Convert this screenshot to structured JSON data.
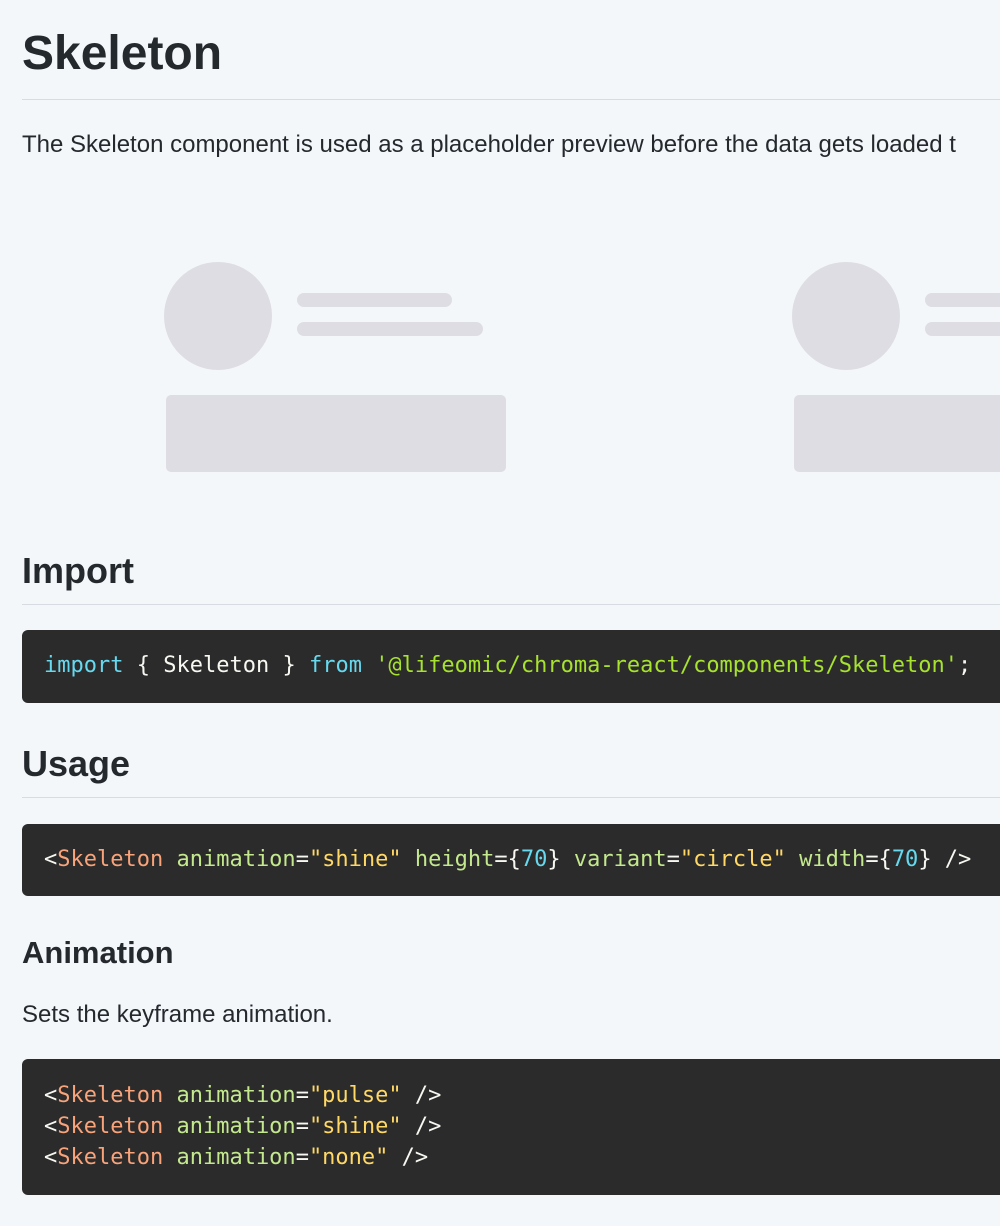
{
  "page": {
    "title": "Skeleton",
    "intro": "The Skeleton component is used as a placeholder preview before the data gets loaded t"
  },
  "sections": {
    "import": {
      "heading": "Import",
      "code": {
        "kw_import": "import",
        "brace_open": " { ",
        "name": "Skeleton",
        "brace_close": " } ",
        "kw_from": "from",
        "space": " ",
        "path": "'@lifeomic/chroma-react/components/Skeleton'",
        "semicolon": ";"
      }
    },
    "usage": {
      "heading": "Usage",
      "code": {
        "lt": "<",
        "tag": "Skeleton",
        "a1": "animation",
        "eq1": "=",
        "v1": "\"shine\"",
        "a2": "height",
        "eq2": "={",
        "v2": "70",
        "cb2": "}",
        "a3": "variant",
        "eq3": "=",
        "v3": "\"circle\"",
        "a4": "width",
        "eq4": "={",
        "v4": "70",
        "cb4": "}",
        "close": " />"
      }
    },
    "animation": {
      "heading": "Animation",
      "description": "Sets the keyframe animation.",
      "lines": [
        {
          "lt": "<",
          "tag": "Skeleton",
          "attr": "animation",
          "eq": "=",
          "value": "\"pulse\"",
          "close": " />"
        },
        {
          "lt": "<",
          "tag": "Skeleton",
          "attr": "animation",
          "eq": "=",
          "value": "\"shine\"",
          "close": " />"
        },
        {
          "lt": "<",
          "tag": "Skeleton",
          "attr": "animation",
          "eq": "=",
          "value": "\"none\"",
          "close": " />"
        }
      ]
    }
  },
  "colors": {
    "page_bg": "#f4f7fa",
    "skeleton_fill": "#dddde3",
    "code_bg": "#2b2b2b",
    "keyword": "#66d9ef",
    "string": "#a6e22e",
    "tag": "#f8a37a",
    "attribute": "#c3e88d",
    "attribute_value": "#ffd866"
  }
}
